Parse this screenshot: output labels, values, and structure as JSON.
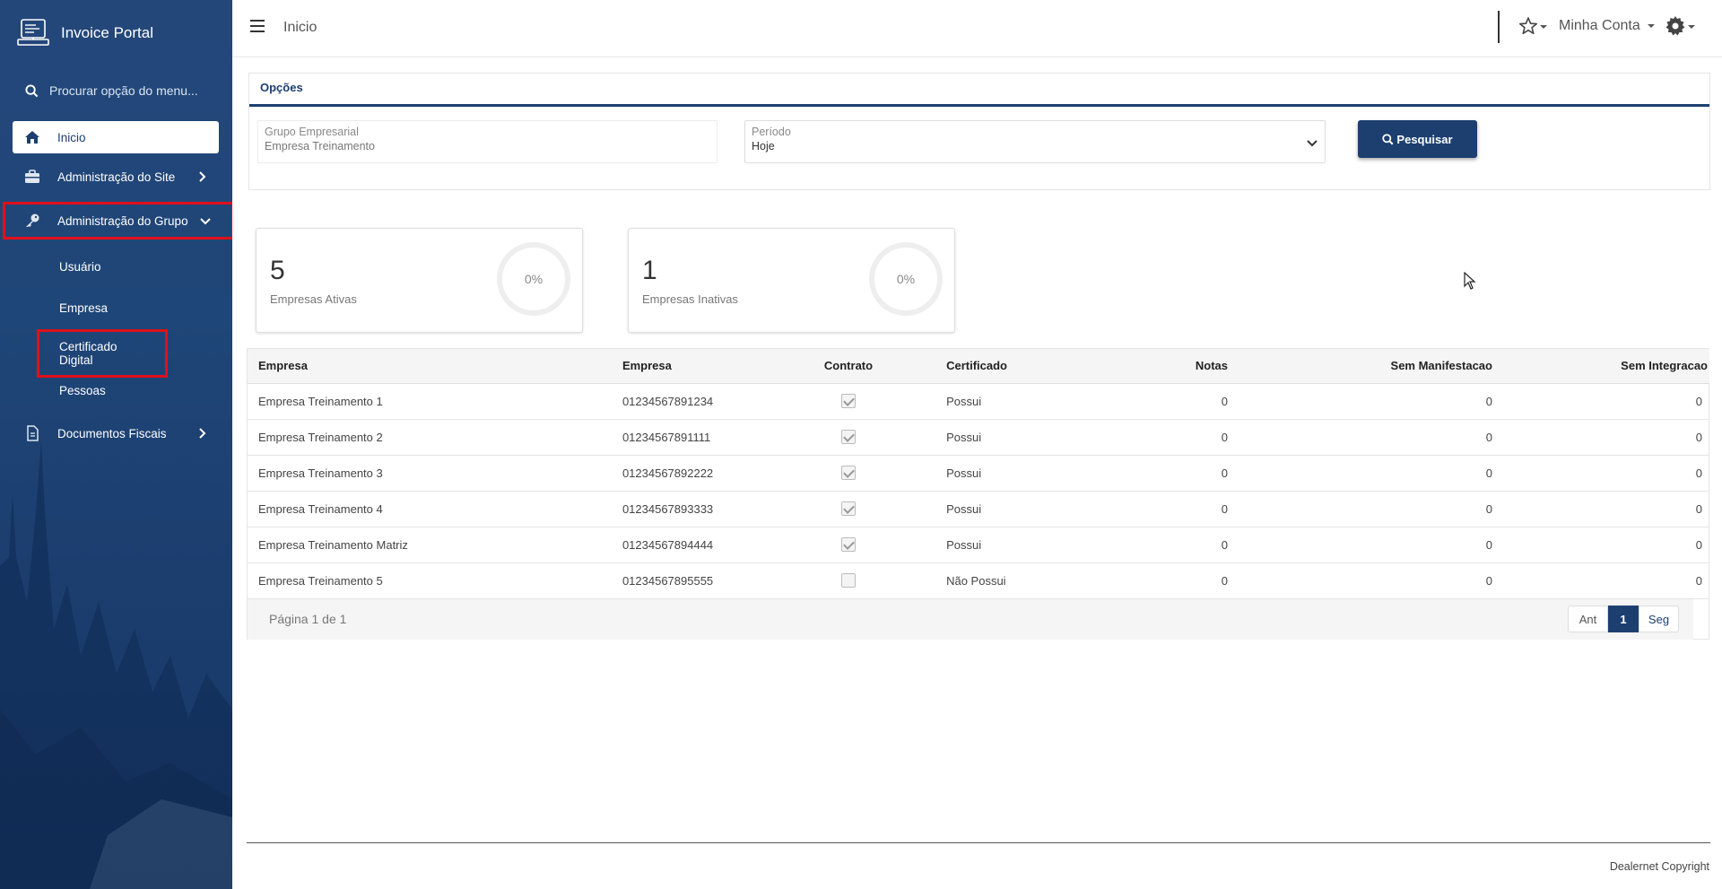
{
  "app": {
    "title": "Invoice Portal"
  },
  "sidebar": {
    "search_placeholder": "Procurar opção do menu...",
    "items": [
      {
        "label": "Inicio",
        "icon": "home-icon",
        "active": true
      },
      {
        "label": "Administração do Site",
        "icon": "briefcase-icon"
      },
      {
        "label": "Administração do Grupo",
        "icon": "key-icon",
        "expanded": true
      },
      {
        "label": "Documentos Fiscais",
        "icon": "document-icon"
      }
    ],
    "subitems": [
      {
        "label": "Usuário"
      },
      {
        "label": "Empresa"
      },
      {
        "label": "Certificado Digital"
      },
      {
        "label": "Pessoas"
      }
    ]
  },
  "topbar": {
    "page_title": "Inicio",
    "account_label": "Minha Conta"
  },
  "options": {
    "title": "Opções",
    "grupo": {
      "label": "Grupo Empresarial",
      "value": "Empresa Treinamento"
    },
    "periodo": {
      "label": "Período",
      "value": "Hoje"
    },
    "search_button": "Pesquisar"
  },
  "stats": [
    {
      "value": "5",
      "label": "Empresas Ativas",
      "percent": "0%"
    },
    {
      "value": "1",
      "label": "Empresas Inativas",
      "percent": "0%"
    }
  ],
  "table": {
    "columns": [
      "Empresa",
      "Empresa",
      "Contrato",
      "Certificado",
      "Notas",
      "Sem Manifestacao",
      "Sem Integracao"
    ],
    "rows": [
      {
        "empresa": "Empresa Treinamento 1",
        "cnpj": "01234567891234",
        "contrato": true,
        "certificado": "Possui",
        "notas": "0",
        "sem_manifestacao": "0",
        "sem_integracao": "0"
      },
      {
        "empresa": "Empresa Treinamento 2",
        "cnpj": "01234567891111",
        "contrato": true,
        "certificado": "Possui",
        "notas": "0",
        "sem_manifestacao": "0",
        "sem_integracao": "0"
      },
      {
        "empresa": "Empresa Treinamento 3",
        "cnpj": "01234567892222",
        "contrato": true,
        "certificado": "Possui",
        "notas": "0",
        "sem_manifestacao": "0",
        "sem_integracao": "0"
      },
      {
        "empresa": "Empresa Treinamento 4",
        "cnpj": "01234567893333",
        "contrato": true,
        "certificado": "Possui",
        "notas": "0",
        "sem_manifestacao": "0",
        "sem_integracao": "0"
      },
      {
        "empresa": "Empresa Treinamento Matriz",
        "cnpj": "01234567894444",
        "contrato": true,
        "certificado": "Possui",
        "notas": "0",
        "sem_manifestacao": "0",
        "sem_integracao": "0"
      },
      {
        "empresa": "Empresa Treinamento 5",
        "cnpj": "01234567895555",
        "contrato": false,
        "certificado": "Não Possui",
        "notas": "0",
        "sem_manifestacao": "0",
        "sem_integracao": "0"
      }
    ],
    "pagination": {
      "info": "Página 1 de 1",
      "prev": "Ant",
      "current": "1",
      "next": "Seg"
    }
  },
  "footer": {
    "text": "Dealernet Copyright"
  },
  "colors": {
    "primary": "#1c3f70",
    "highlight": "#e0101b",
    "sidebar_bg": "#1f4678"
  }
}
